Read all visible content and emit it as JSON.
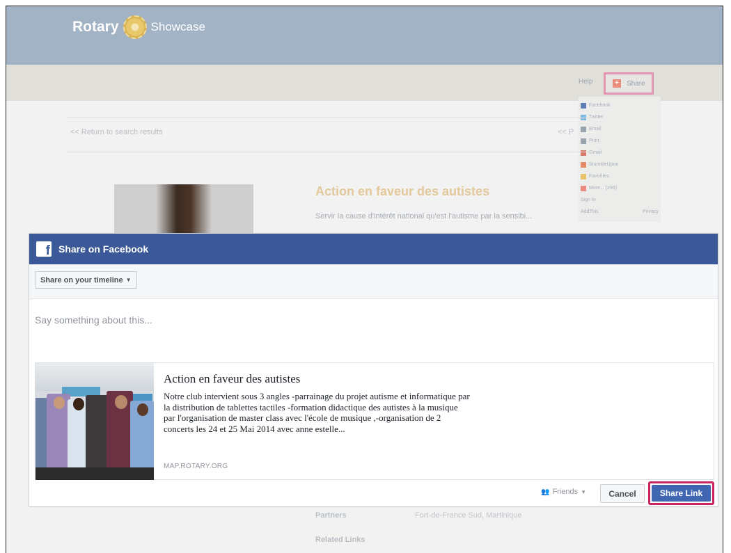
{
  "site": {
    "logo_text": "Rotary",
    "logo_suffix": "Showcase",
    "help": "Help",
    "share_label": "Share",
    "return_link": "<< Return to search results",
    "prev_link": "<< P",
    "page_title": "Action en faveur des autistes",
    "page_desc": "Servir la cause d'intérêt national qu'est l'autisme par la sensibi...",
    "partners_label": "Partners",
    "partners_value": "Fort-de-France Sud, Martinique",
    "related_label": "Related Links"
  },
  "share_menu": {
    "items": [
      {
        "label": "Facebook",
        "icon": "facebook-icon",
        "color": "#5d7cb3"
      },
      {
        "label": "Twitter",
        "icon": "twitter-icon",
        "color": "#7fb9e0"
      },
      {
        "label": "Email",
        "icon": "email-icon",
        "color": "#9aa4ae"
      },
      {
        "label": "Print",
        "icon": "print-icon",
        "color": "#9aa4ae"
      },
      {
        "label": "Gmail",
        "icon": "gmail-icon",
        "color": "#d97a6c"
      },
      {
        "label": "StumbleUpon",
        "icon": "stumbleupon-icon",
        "color": "#e78a6a"
      },
      {
        "label": "Favorites",
        "icon": "favorites-icon",
        "color": "#e9c36c"
      },
      {
        "label": "More... (295)",
        "icon": "more-icon",
        "color": "#e88b85"
      }
    ],
    "sign_in": "Sign In",
    "footer_left": "AddThis",
    "footer_right": "Privacy"
  },
  "dialog": {
    "title": "Share on Facebook",
    "timeline_button": "Share on your timeline",
    "say_placeholder": "Say something about this...",
    "attachment": {
      "title": "Action en faveur des autistes",
      "description": "Notre club intervient sous 3 angles -parrainage du projet autisme et informatique par la distribution de tablettes tactiles -formation didactique des autistes à la musique par l'organisation de master class avec l'école de musique ,-organisation de 2 concerts les 24 et 25 Mai 2014 avec anne estelle...",
      "domain": "MAP.ROTARY.ORG"
    },
    "audience": "Friends",
    "cancel": "Cancel",
    "share_link": "Share Link"
  },
  "colors": {
    "facebook_blue": "#3b5998",
    "share_link_button": "#4267b2",
    "highlight_border": "#c8245f"
  }
}
